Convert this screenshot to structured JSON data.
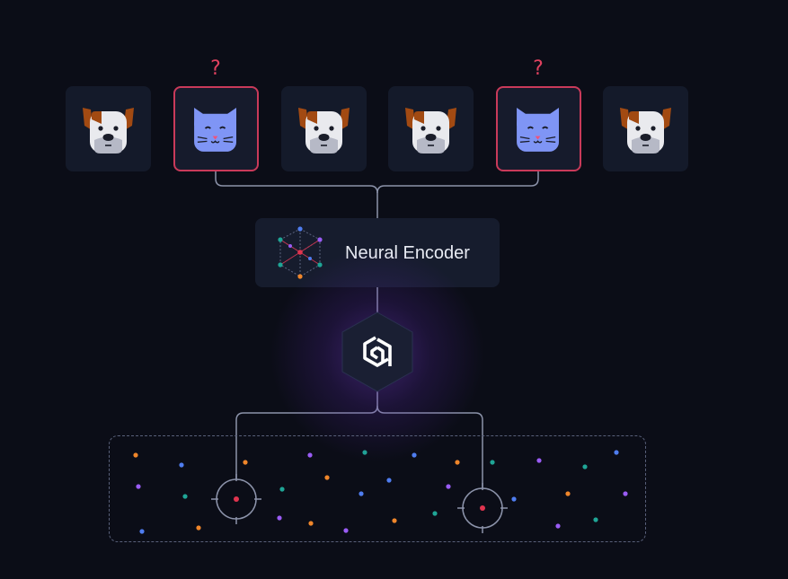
{
  "encoder": {
    "label": "Neural Encoder"
  },
  "question_mark": "?",
  "inputs": [
    {
      "kind": "dog",
      "flagged": false
    },
    {
      "kind": "cat",
      "flagged": true
    },
    {
      "kind": "dog",
      "flagged": false
    },
    {
      "kind": "dog",
      "flagged": false
    },
    {
      "kind": "cat",
      "flagged": true
    },
    {
      "kind": "dog",
      "flagged": false
    }
  ],
  "icons": {
    "dog": "dog-face-icon",
    "cat": "cat-face-icon",
    "encoder": "neural-network-cube-icon",
    "hub": "vector-database-hexagon-icon",
    "target": "crosshair-icon"
  },
  "colors": {
    "background": "#0b0d17",
    "card": "#141a2a",
    "flag_border": "#c93a5a",
    "question_mark": "#e0415f",
    "connector": "#8c93aa",
    "point_orange": "#f0862a",
    "point_blue": "#4f7df0",
    "point_purple": "#9a5cf5",
    "point_teal": "#1fa596",
    "point_red": "#e0344f"
  }
}
